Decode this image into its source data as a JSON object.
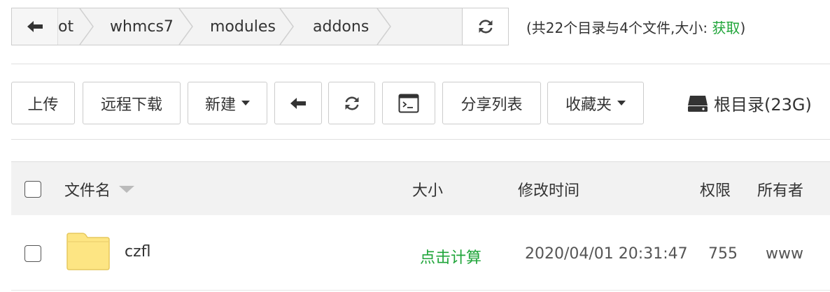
{
  "path_bar": {
    "crumbs": [
      "ot",
      "whmcs7",
      "modules",
      "addons"
    ],
    "summary_prefix": "(共22个目录与4个文件,大小: ",
    "summary_get": "获取",
    "summary_suffix": ")"
  },
  "toolbar": {
    "upload": "上传",
    "remote_download": "远程下载",
    "new": "新建",
    "share_list": "分享列表",
    "favorites": "收藏夹",
    "disk_label": "根目录(23G)"
  },
  "table": {
    "headers": {
      "name": "文件名",
      "size": "大小",
      "mtime": "修改时间",
      "perm": "权限",
      "owner": "所有者"
    },
    "rows": [
      {
        "name": "czfl",
        "size": "点击计算",
        "mtime": "2020/04/01 20:31:47",
        "perm": "755",
        "owner": "www"
      }
    ]
  },
  "colors": {
    "accent_green": "#20a53a",
    "folder_yellow": "#fde583"
  },
  "icons": [
    "back-arrow-icon",
    "refresh-icon",
    "terminal-icon",
    "disk-icon",
    "folder-icon",
    "chevron-down-icon"
  ]
}
